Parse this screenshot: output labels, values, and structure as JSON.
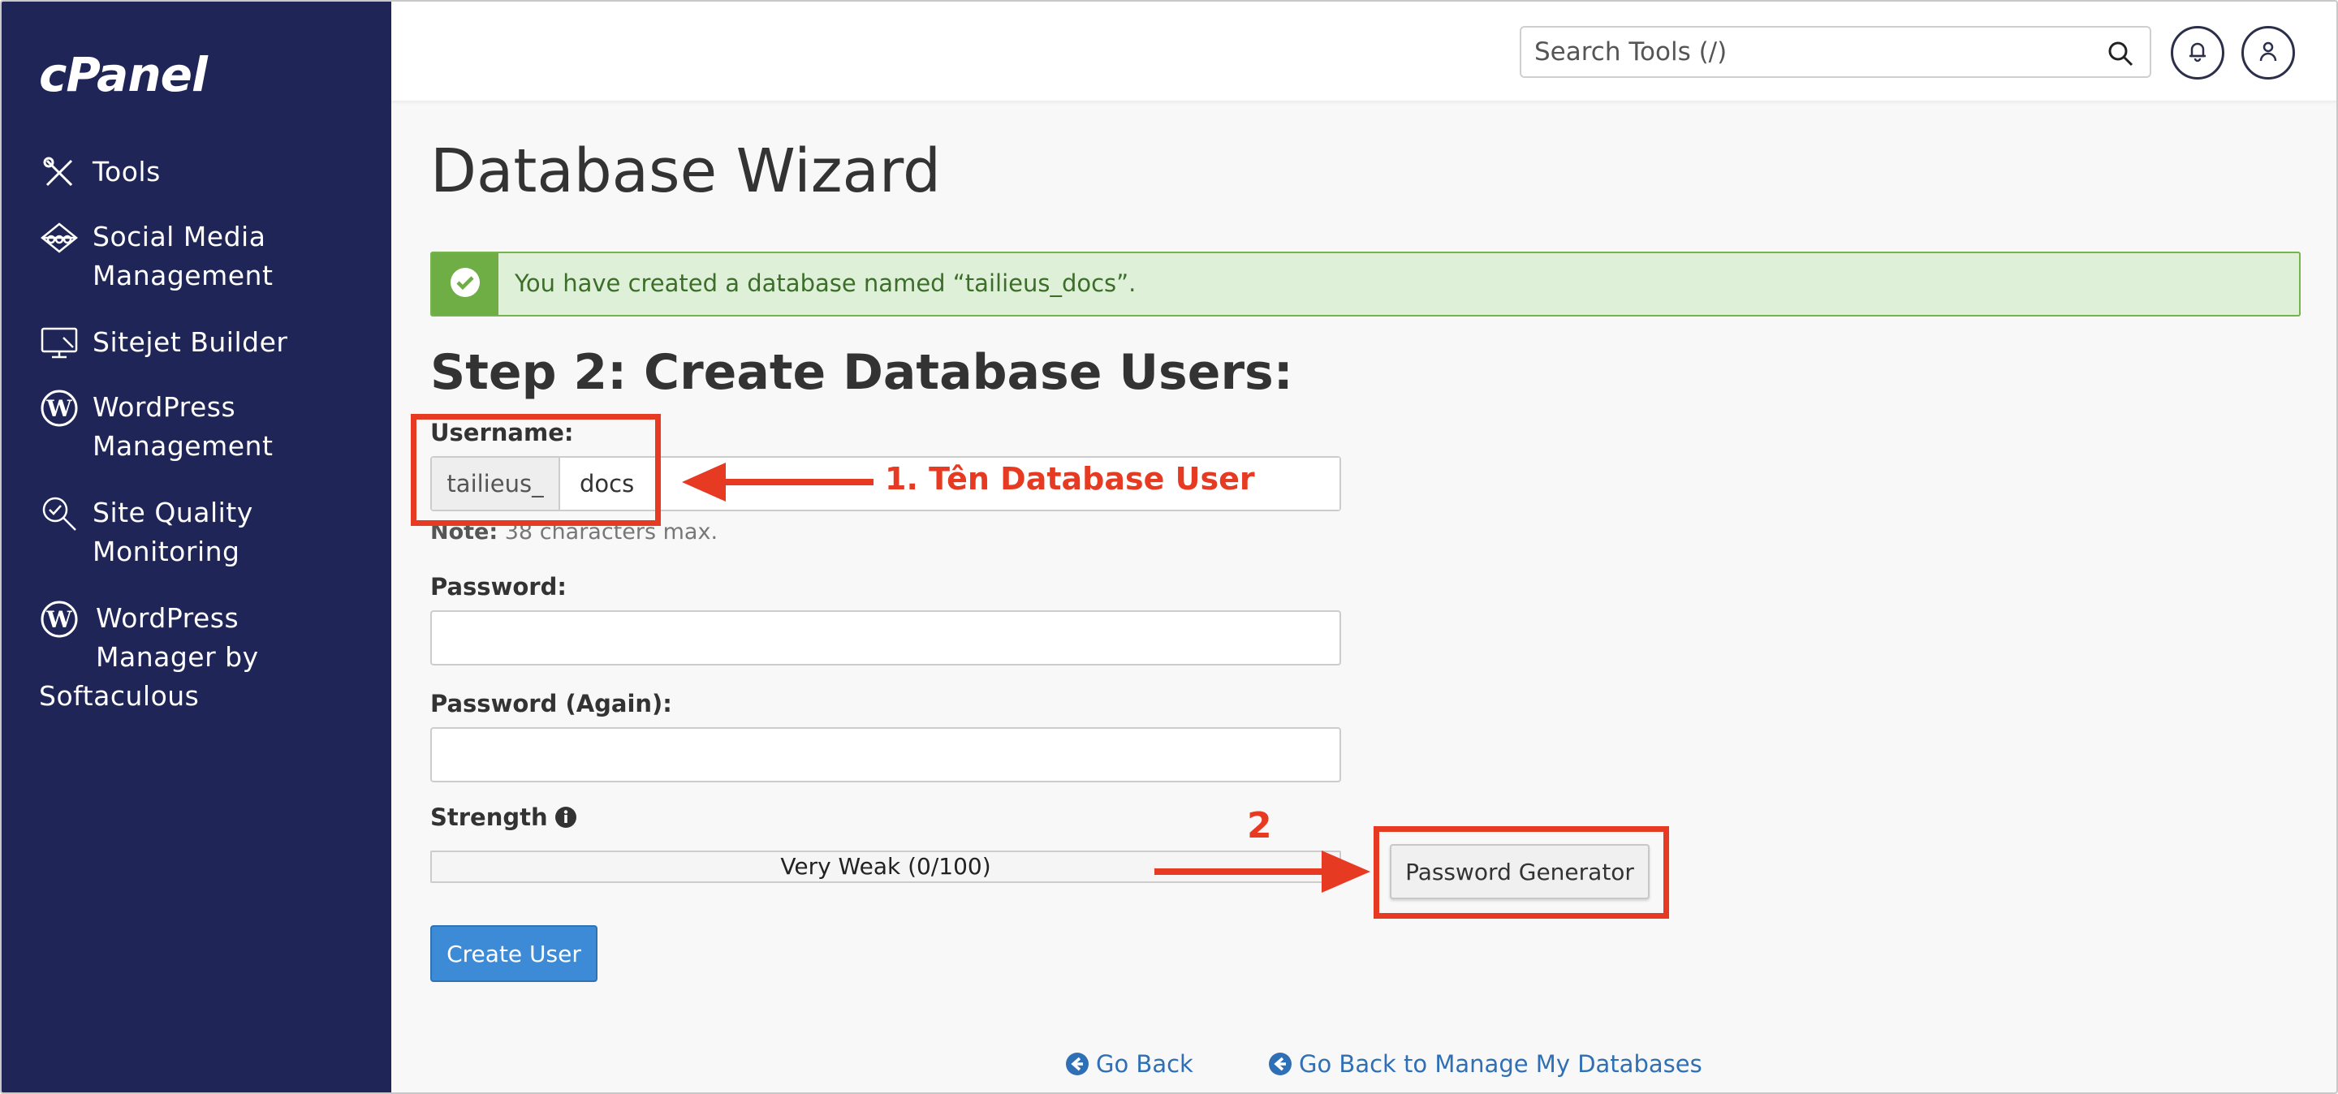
{
  "app": {
    "logo": "cPanel"
  },
  "sidebar": {
    "items": [
      {
        "label": "Tools",
        "icon": "tools-icon"
      },
      {
        "label": "Social Media Management",
        "line1": "Social Media",
        "line2": "Management",
        "icon": "social-media-icon"
      },
      {
        "label": "Sitejet Builder",
        "icon": "sitejet-icon"
      },
      {
        "label": "WordPress Management",
        "line1": "WordPress",
        "line2": "Management",
        "icon": "wordpress-icon"
      },
      {
        "label": "Site Quality Monitoring",
        "line1": "Site Quality",
        "line2": "Monitoring",
        "icon": "site-quality-icon"
      },
      {
        "label": "WordPress Manager by Softaculous",
        "line1": "WordPress",
        "line2": "Manager by",
        "line3": "Softaculous",
        "icon": "wordpress-icon"
      }
    ]
  },
  "header": {
    "search_placeholder": "Search Tools (/)"
  },
  "main": {
    "title": "Database Wizard",
    "alert": "You have created a database named “tailieus_docs”.",
    "step_title": "Step 2: Create Database Users:",
    "username_label": "Username:",
    "username_prefix": "tailieus_",
    "username_value": "docs",
    "note_bold": "Note:",
    "note_text": " 38 characters max.",
    "password_label": "Password:",
    "password_again_label": "Password (Again):",
    "strength_label": "Strength",
    "strength_text": "Very Weak (0/100)",
    "strength_value": 0,
    "password_generator_label": "Password Generator",
    "create_user_label": "Create User",
    "go_back_label": "Go Back",
    "go_back_manage_label": "Go Back to Manage My Databases"
  },
  "annotations": {
    "label1": "1. Tên Database User",
    "label2": "2",
    "color": "#e63a23"
  }
}
